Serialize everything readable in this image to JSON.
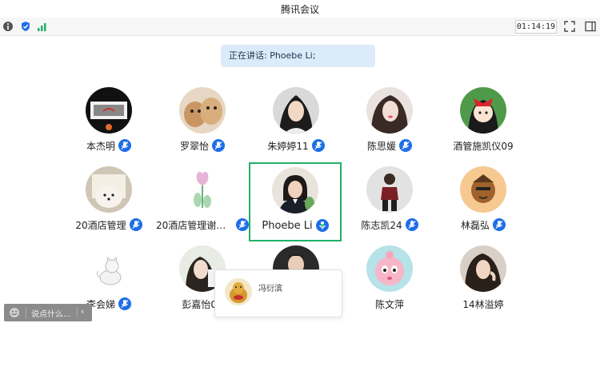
{
  "window": {
    "title": "腾讯会议"
  },
  "toolbar": {
    "timer": "01:14:19"
  },
  "speaking_banner": {
    "text": "正在讲话: Phoebe Li;"
  },
  "participants": [
    {
      "name": "本杰明",
      "mic": "muted"
    },
    {
      "name": "罗翠怡",
      "mic": "muted"
    },
    {
      "name": "朱婷婷11",
      "mic": "muted"
    },
    {
      "name": "陈思媛",
      "mic": "muted"
    },
    {
      "name": "酒管施凯仪09",
      "mic": "none"
    },
    {
      "name": "20酒店管理",
      "mic": "muted"
    },
    {
      "name": "20酒店管理谢熳...",
      "mic": "muted"
    },
    {
      "name": "Phoebe Li",
      "mic": "speaking"
    },
    {
      "name": "陈志凯24",
      "mic": "muted"
    },
    {
      "name": "林磊弘",
      "mic": "muted"
    },
    {
      "name": "李会娣",
      "mic": "muted"
    },
    {
      "name": "彭嘉怡07",
      "mic": "none"
    },
    {
      "name": "",
      "mic": "none"
    },
    {
      "name": "陈文萍",
      "mic": "none"
    },
    {
      "name": "14林溢婷",
      "mic": "none"
    }
  ],
  "hover_card": {
    "name": "冯衍滨"
  },
  "chat_input": {
    "placeholder": "说点什么...",
    "collapse": "‹"
  },
  "colors": {
    "accent_blue": "#1e6ee8",
    "speaking_green": "#22b06a",
    "banner_bg": "#dcebfa"
  }
}
